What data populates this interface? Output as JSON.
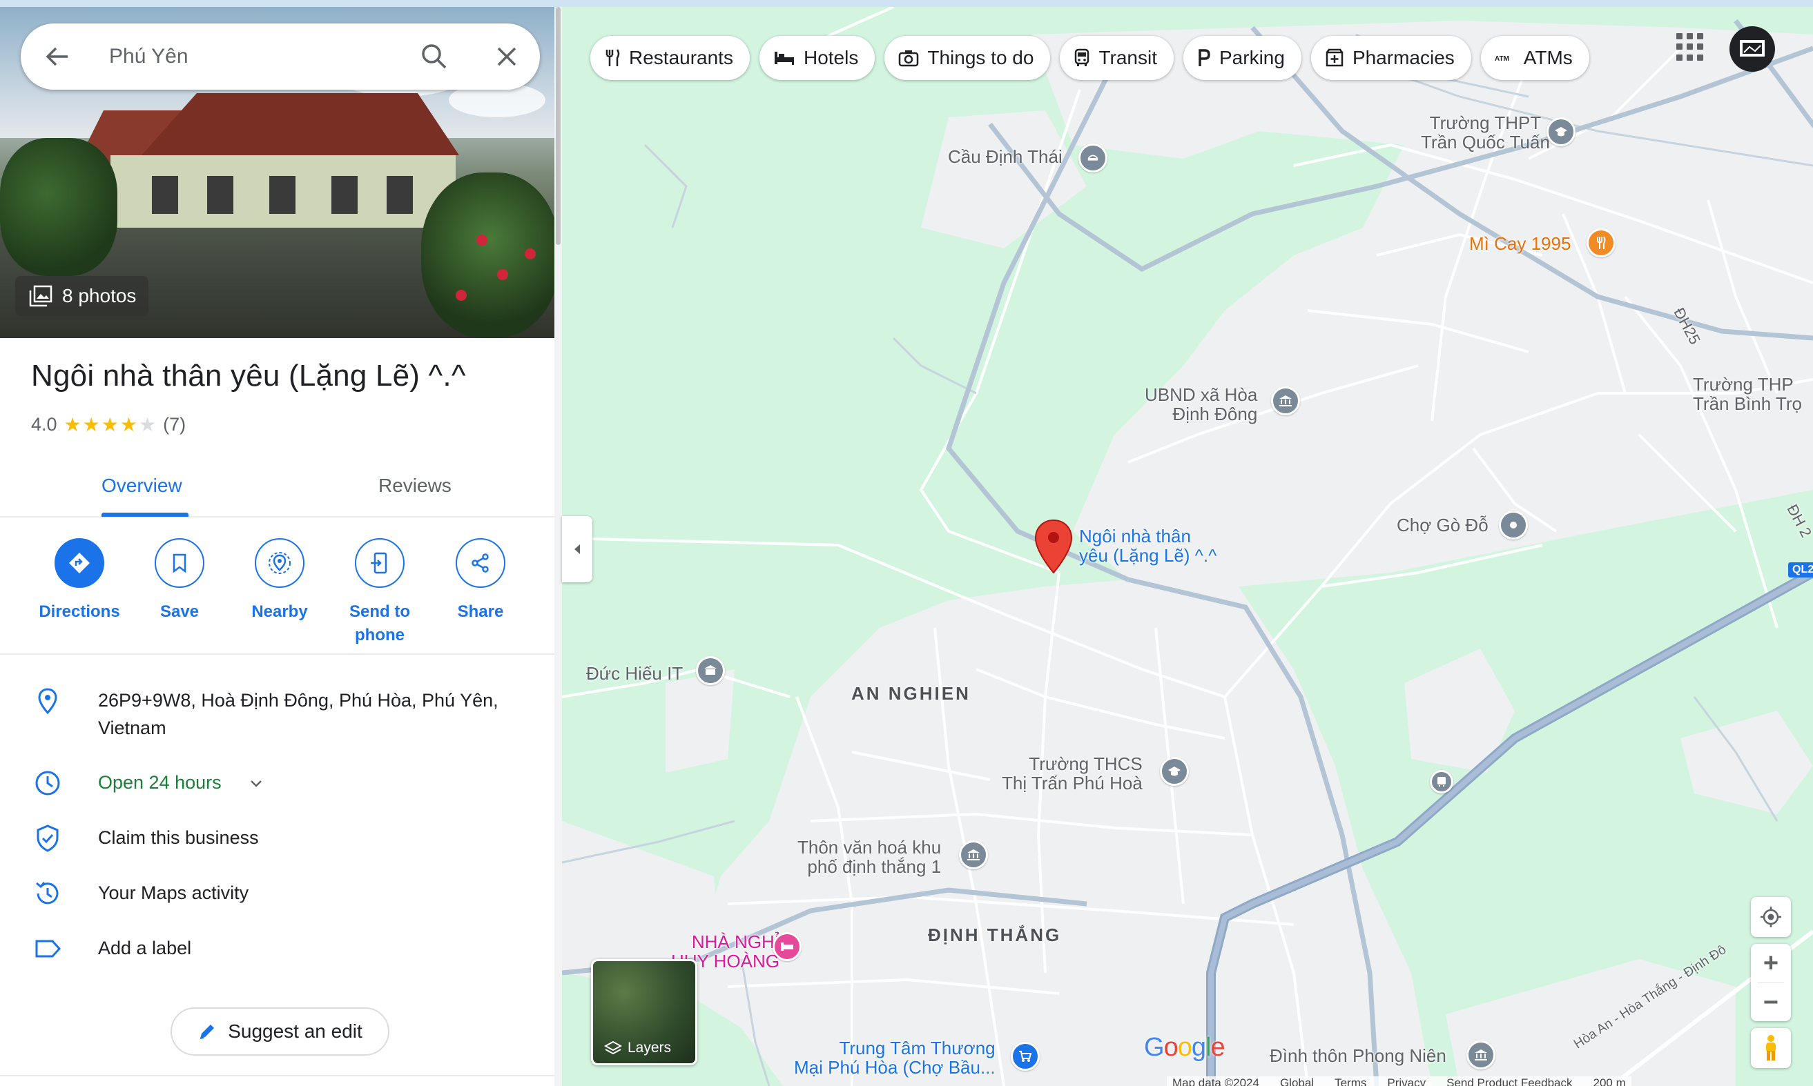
{
  "search": {
    "query": "Phú Yên"
  },
  "place": {
    "photos_label": "8 photos",
    "title": "Ngôi nhà thân yêu (Lặng Lẽ) ^.^",
    "rating": "4.0",
    "stars": 4,
    "review_count": "(7)"
  },
  "tabs": [
    {
      "label": "Overview"
    },
    {
      "label": "Reviews"
    }
  ],
  "actions": [
    {
      "label": "Directions"
    },
    {
      "label": "Save"
    },
    {
      "label": "Nearby"
    },
    {
      "label": "Send to phone"
    },
    {
      "label": "Share"
    }
  ],
  "info": {
    "address_line1": "26P9+9W8, Hoà Định Đông, Phú Hòa, Phú Yên,",
    "address_line2": "Vietnam",
    "hours": "Open 24 hours",
    "claim": "Claim this business",
    "activity": "Your Maps activity",
    "label": "Add a label",
    "suggest": "Suggest an edit"
  },
  "categories": [
    {
      "label": "Restaurants",
      "icon": "fork-knife-icon"
    },
    {
      "label": "Hotels",
      "icon": "bed-icon"
    },
    {
      "label": "Things to do",
      "icon": "camera-icon"
    },
    {
      "label": "Transit",
      "icon": "bus-icon"
    },
    {
      "label": "Parking",
      "icon": "parking-icon"
    },
    {
      "label": "Pharmacies",
      "icon": "pharmacy-icon"
    },
    {
      "label": "ATMs",
      "icon": "atm-icon"
    }
  ],
  "map": {
    "labels": {
      "cau_dinh_thai": "Cầu Định Thái",
      "thpt_line1": "Trường THPT",
      "thpt_line2": "Trần Quốc Tuấn",
      "mi_cay": "Mì Cay 1995",
      "dh25": "ĐH25",
      "thpt2_line1": "Trường THP",
      "thpt2_line2": "Trần Bình Trọ",
      "ubnd_line1": "UBND xã Hòa",
      "ubnd_line2": "Định Đông",
      "pin_line1": "Ngôi nhà thân",
      "pin_line2": "yêu (Lặng Lẽ) ^.^",
      "cho_go_do": "Chợ Gò Đỗ",
      "dh2": "ĐH 2",
      "ql": "QL2",
      "duc_hieu": "Đức Hiếu IT",
      "an_nghien": "AN NGHIEN",
      "thcs_line1": "Trường THCS",
      "thcs_line2": "Thị Trấn Phú Hoà",
      "thon_line1": "Thôn văn hoá khu",
      "thon_line2": "phố định thắng 1",
      "nha_nghi_line1": "NHÀ NGHỈ",
      "nha_nghi_line2": "HUY HOÀNG",
      "dinh_thang": "ĐỊNH THẮNG",
      "trung_tam_line1": "Trung Tâm Thương",
      "trung_tam_line2": "Mại Phú Hòa (Chợ Bầu...",
      "dinh_thon": "Đình thôn Phong Niên",
      "road_diag": "Hòa An - Hòa Thắng - Định Đô"
    },
    "layers_label": "Layers",
    "google": "Google",
    "footer": [
      "Map data ©2024",
      "Global",
      "Terms",
      "Privacy",
      "Send Product Feedback",
      "200 m"
    ]
  },
  "colors": {
    "accent": "#1a73e8",
    "open_green": "#188038",
    "pin_red": "#ea4335",
    "map_green": "#d3f5e0"
  }
}
